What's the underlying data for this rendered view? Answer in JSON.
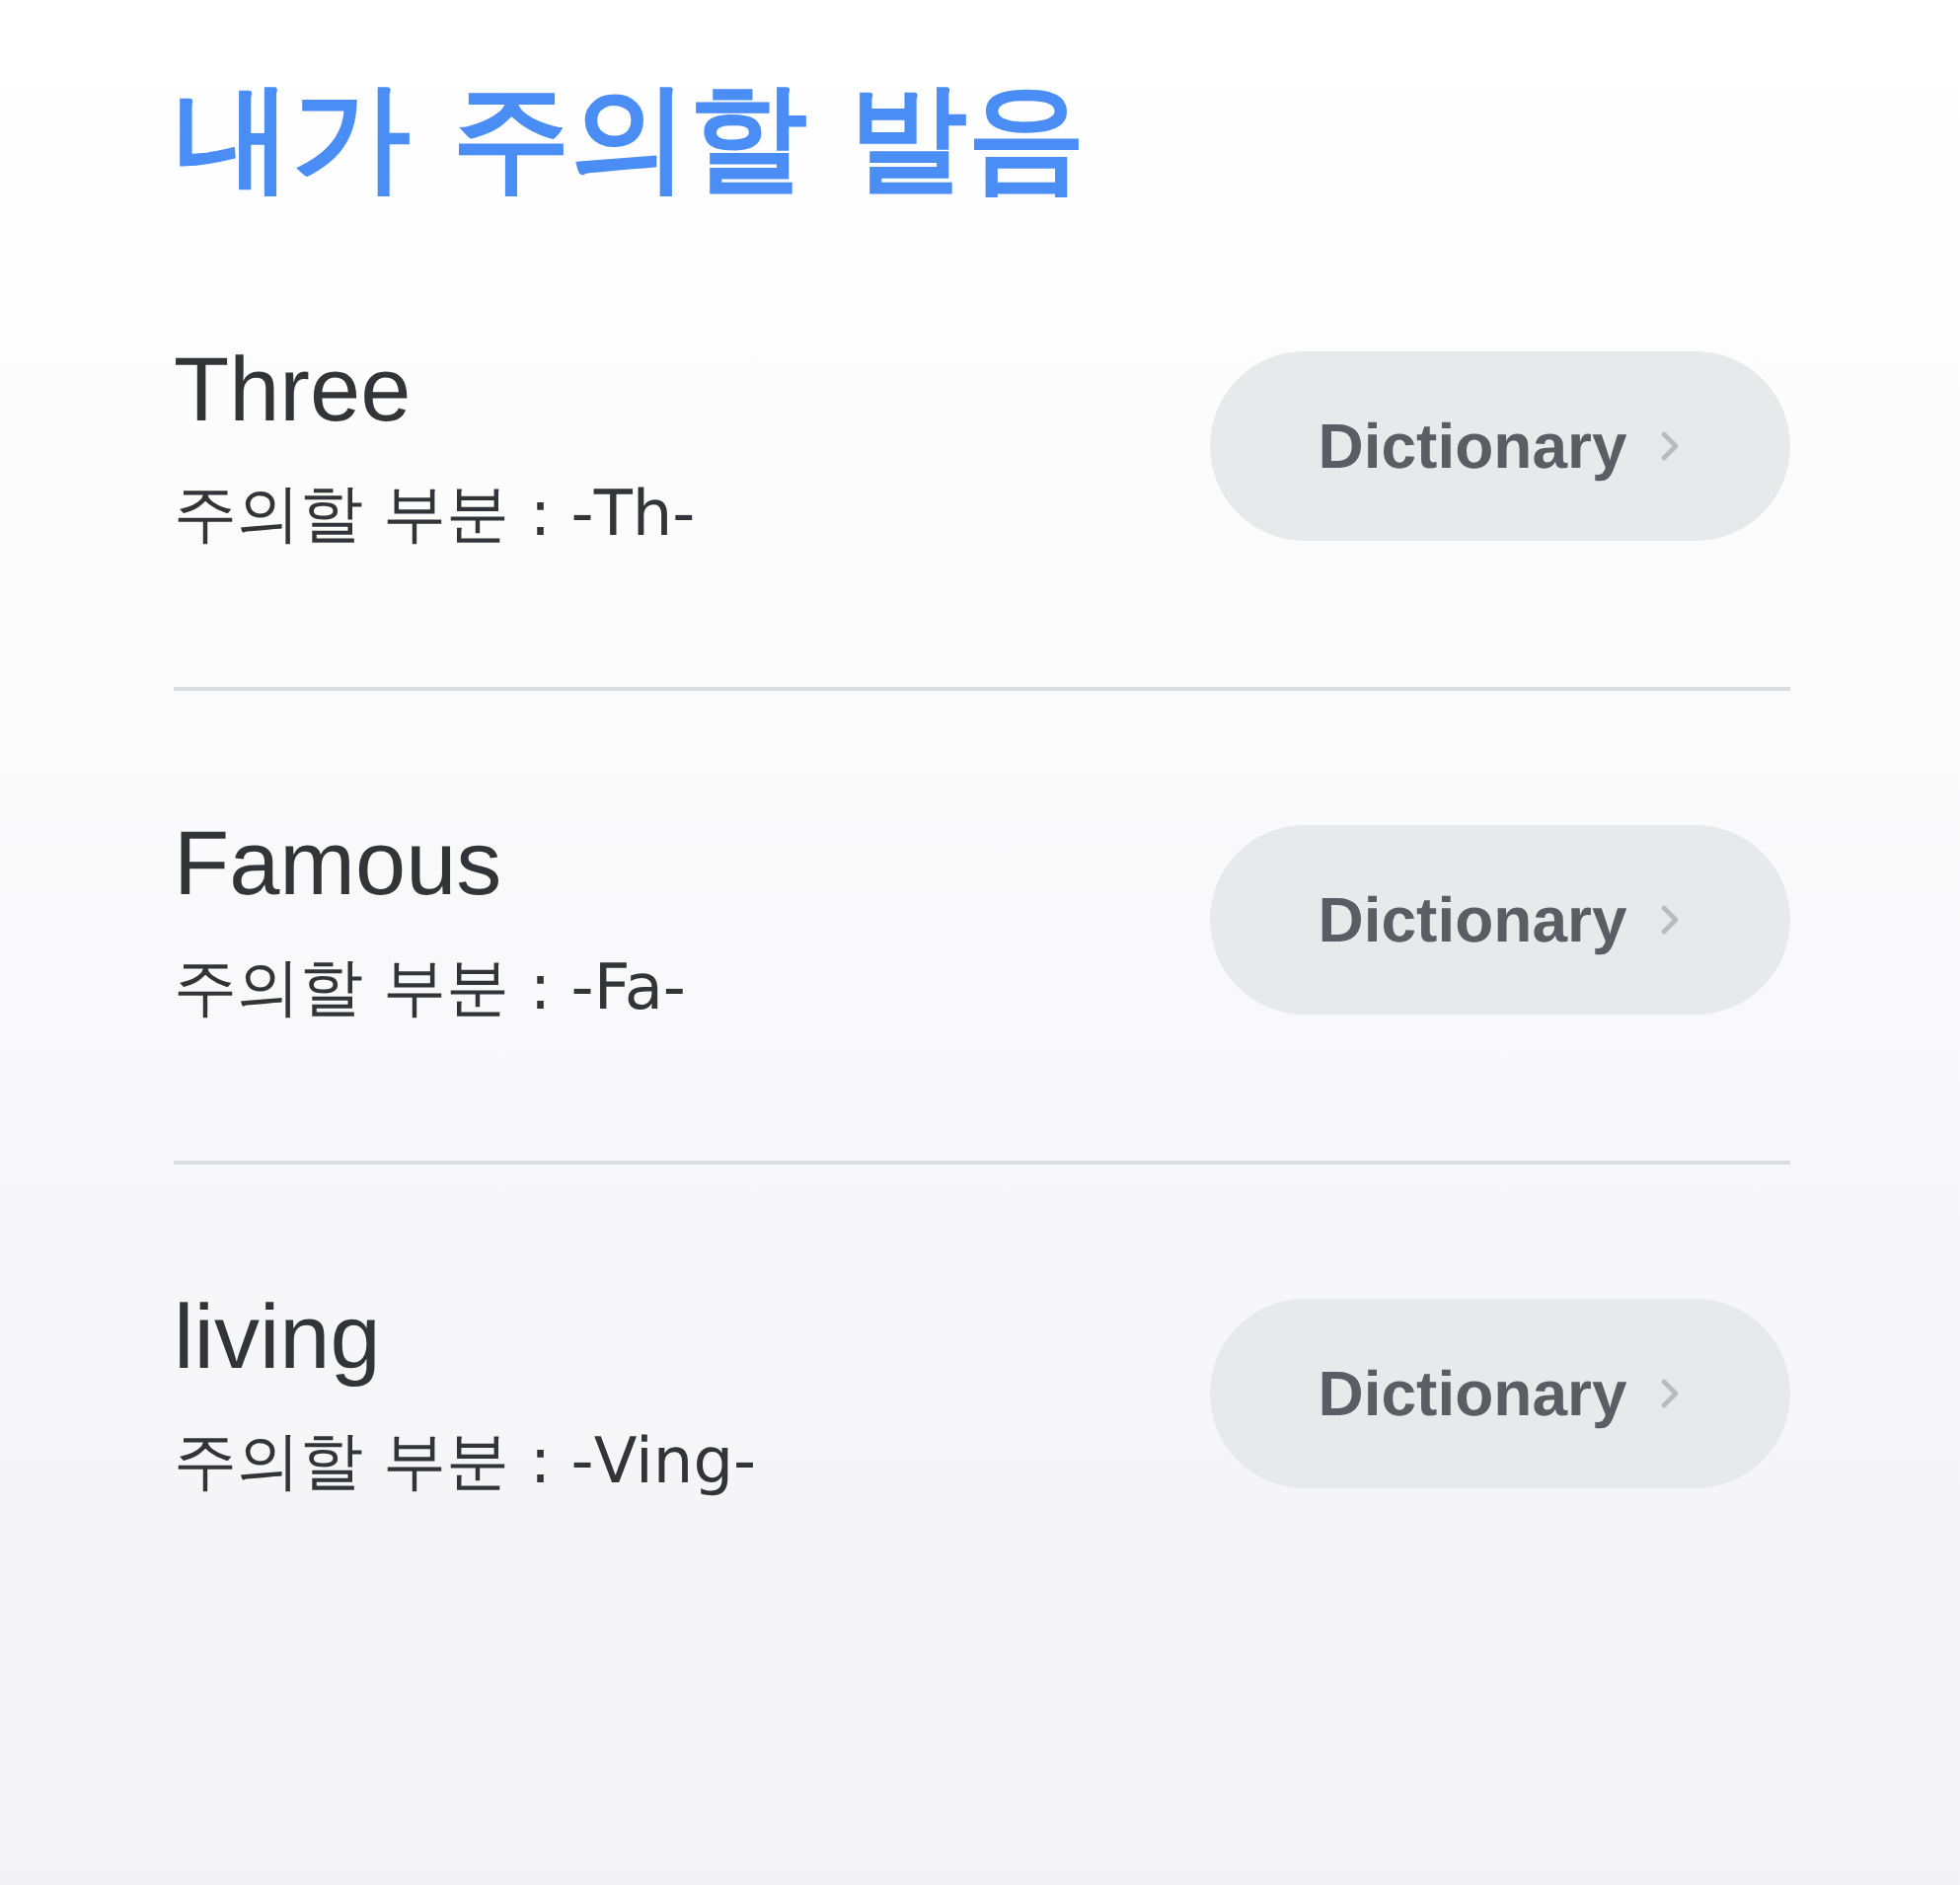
{
  "title": "내가 주의할 발음",
  "words": [
    {
      "word": "Three",
      "note": "주의할 부분 : -Th-",
      "button": "Dictionary"
    },
    {
      "word": "Famous",
      "note": "주의할 부분 : -Fa-",
      "button": "Dictionary"
    },
    {
      "word": "living",
      "note": "주의할 부분 : -Ving-",
      "button": "Dictionary"
    }
  ]
}
